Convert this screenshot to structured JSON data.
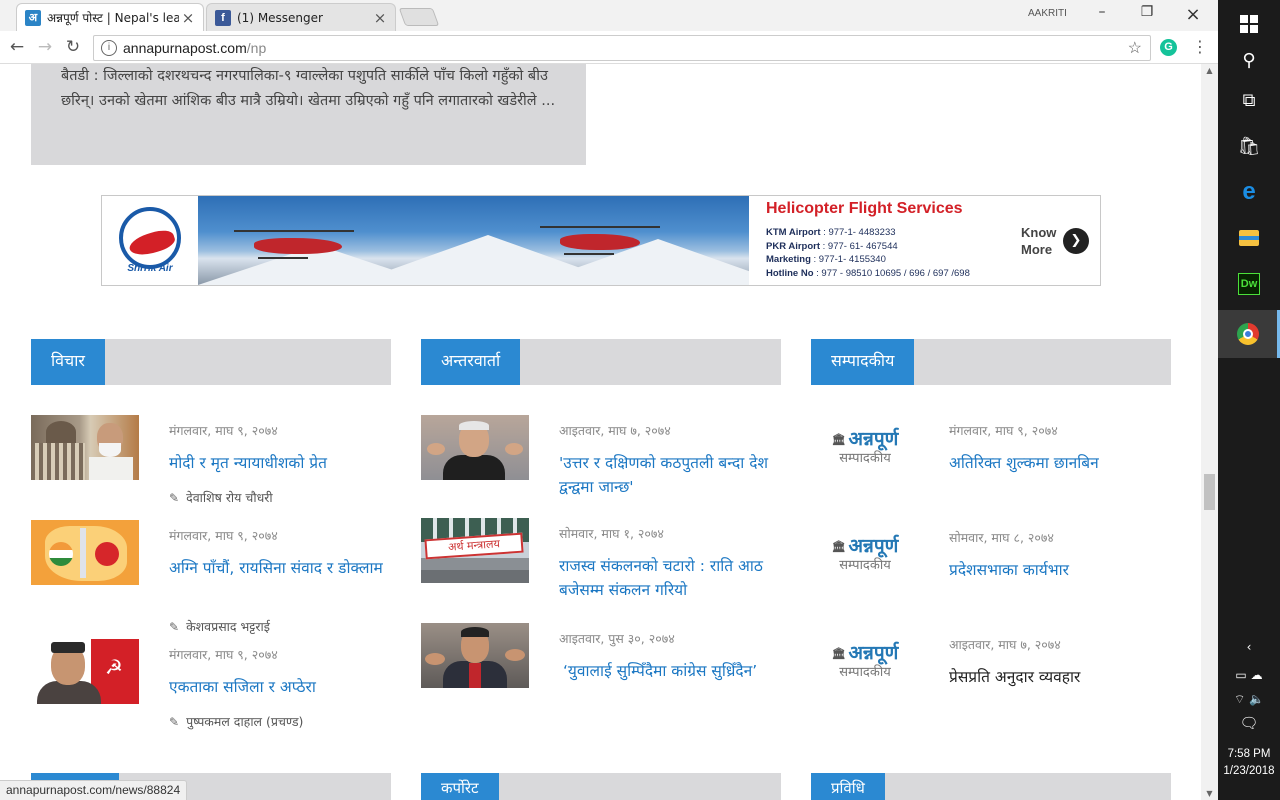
{
  "browser": {
    "tabs": [
      {
        "title": "अन्नपूर्ण पोस्ट | Nepal's lea",
        "favicon": "annapurna-favicon",
        "active": true
      },
      {
        "title": "(1) Messenger",
        "favicon": "facebook-favicon",
        "active": false
      }
    ],
    "profile_name": "AAKRITI",
    "url_host": "annapurnapost.com",
    "url_path": "/np",
    "status_url": "annapurnapost.com/news/88824"
  },
  "page": {
    "excerpt": "बैतडी : जिल्लाको दशरथचन्द नगरपालिका-९ ग्वाल्लेका पशुपति सार्कीले पाँच किलो गहुँको बीउ छरिन्। उनको खेतमा आंशिक बीउ मात्रै उम्रियो। खेतमा उम्रिएको गहुँ पनि लगातारको खडेरीले ...",
    "ad": {
      "logo_text": "Shrrik Air",
      "title": "Helicopter Flight Services",
      "lines": [
        {
          "label": "KTM Airport",
          "value": " : 977-1- 4483233"
        },
        {
          "label": "PKR Airport",
          "value": " : 977- 61- 467544"
        },
        {
          "label": "Marketing",
          "value": " : 977-1- 4155340"
        },
        {
          "label": "Hotline No",
          "value": " : 977 - 98510 10695 / 696 / 697 /698"
        }
      ],
      "cta_line1": "Know",
      "cta_line2": "More"
    },
    "sections": [
      {
        "title": "विचार",
        "items": [
          {
            "date": "मंगलवार, माघ ९, २०७४",
            "headline": "मोदी र मृत न्यायाधीशको प्रेत",
            "author": "देवाशिष रोय चौधरी"
          },
          {
            "date": "मंगलवार, माघ ९, २०७४",
            "headline": "अग्नि पाँचौं, रायसिना संवाद र डोक्लाम",
            "author": "केशवप्रसाद भट्टराई"
          },
          {
            "date": "मंगलवार, माघ ९, २०७४",
            "headline": "एकताका सजिला र अप्ठेरा",
            "author": "पुष्पकमल दाहाल (प्रचण्ड)"
          }
        ]
      },
      {
        "title": "अन्तरवार्ता",
        "items": [
          {
            "date": "आइतवार, माघ ७, २०७४",
            "headline": "'उत्तर र दक्षिणको कठपुतली बन्दा देश द्वन्द्वमा जान्छ'"
          },
          {
            "date": "सोमवार, माघ १, २०७४",
            "headline": "राजस्व संकलनको चटारो : राति आठ बजेसम्म संकलन गरियो"
          },
          {
            "date": "आइतवार, पुस ३०, २०७४",
            "headline": "‘युवालाई सुम्पिँदैमा कांग्रेस सुध्रिँदैन’"
          }
        ]
      },
      {
        "title": "सम्पादकीय",
        "editorial_logo_title": "अन्नपूर्ण",
        "editorial_logo_sub": "सम्पादकीय",
        "items": [
          {
            "date": "मंगलवार, माघ ९, २०७४",
            "headline": "अतिरिक्त शुल्कमा छानबिन"
          },
          {
            "date": "सोमवार, माघ ८, २०७४",
            "headline": "प्रदेशसभाका कार्यभार"
          },
          {
            "date": "आइतवार, माघ ७, २०७४",
            "headline": "प्रेसप्रति अनुदार व्यवहार"
          }
        ]
      }
    ],
    "bottom_sections": [
      "",
      "कर्पोरेट",
      "प्रविधि"
    ],
    "thumb_sign_text": "अर्थ मन्त्रालय"
  },
  "taskbar": {
    "time": "7:58 PM",
    "date": "1/23/2018",
    "icons": [
      "windows-start-icon",
      "search-icon",
      "task-view-icon",
      "store-icon",
      "edge-icon",
      "file-explorer-icon",
      "dreamweaver-icon",
      "chrome-icon"
    ]
  }
}
